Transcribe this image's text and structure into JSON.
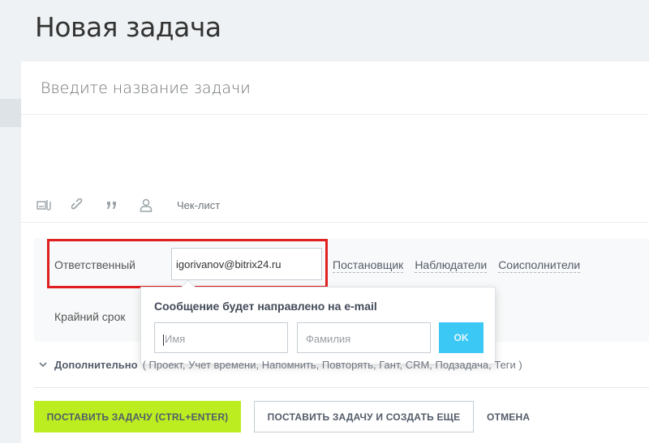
{
  "page": {
    "title": "Новая задача"
  },
  "task": {
    "title_placeholder": "Введите название задачи"
  },
  "toolbar": {
    "icons": [
      "file-upload-icon",
      "link-icon",
      "quote-icon",
      "user-mention-icon"
    ],
    "checklist_label": "Чек-лист"
  },
  "form": {
    "responsible_label": "Ответственный",
    "responsible_value": "igorivanov@bitrix24.ru",
    "role_links": [
      "Постановщик",
      "Наблюдатели",
      "Соисполнители"
    ],
    "deadline_label": "Крайний срок"
  },
  "email_popup": {
    "title": "Сообщение будет направлено на e-mail",
    "first_name_placeholder": "Имя",
    "last_name_placeholder": "Фамилия",
    "ok_label": "OK"
  },
  "additional": {
    "title": "Дополнительно",
    "items": "( Проект, Учет времени, Напомнить, Повторять, Гант, CRM, Подзадача, Теги )"
  },
  "actions": {
    "submit_label": "ПОСТАВИТЬ ЗАДАЧУ (CTRL+ENTER)",
    "submit_more_label": "ПОСТАВИТЬ ЗАДАЧУ И СОЗДАТЬ ЕЩЕ",
    "cancel_label": "ОТМЕНА"
  },
  "colors": {
    "accent_green": "#bbed21",
    "ok_blue": "#3bc8f5",
    "highlight_red": "#e02020"
  }
}
